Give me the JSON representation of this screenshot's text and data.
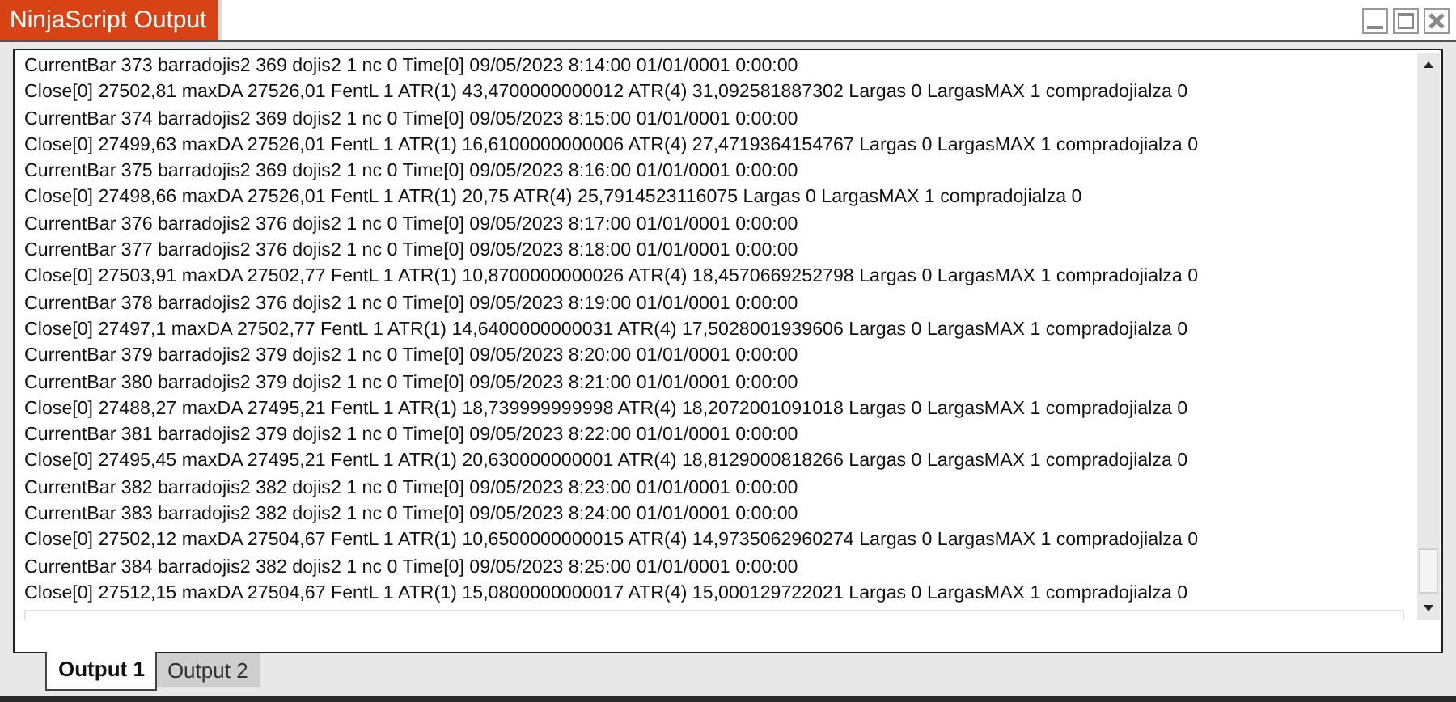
{
  "window": {
    "title": "NinjaScript Output"
  },
  "output_lines": [
    "CurrentBar 373 barradojis2 369 dojis2 1 nc 0 Time[0] 09/05/2023 8:14:00 01/01/0001 0:00:00",
    "Close[0] 27502,81 maxDA 27526,01 FentL 1 ATR(1) 43,4700000000012 ATR(4) 31,092581887302 Largas 0 LargasMAX 1 compradojialza 0",
    "CurrentBar 374 barradojis2 369 dojis2 1 nc 0 Time[0] 09/05/2023 8:15:00 01/01/0001 0:00:00",
    "Close[0] 27499,63 maxDA 27526,01 FentL 1 ATR(1) 16,6100000000006 ATR(4) 27,4719364154767 Largas 0 LargasMAX 1 compradojialza 0",
    "CurrentBar 375 barradojis2 369 dojis2 1 nc 0 Time[0] 09/05/2023 8:16:00 01/01/0001 0:00:00",
    "Close[0] 27498,66 maxDA 27526,01 FentL 1 ATR(1) 20,75 ATR(4) 25,7914523116075 Largas 0 LargasMAX 1 compradojialza 0",
    "CurrentBar 376 barradojis2 376 dojis2 1 nc 0 Time[0] 09/05/2023 8:17:00 01/01/0001 0:00:00",
    "CurrentBar 377 barradojis2 376 dojis2 1 nc 0 Time[0] 09/05/2023 8:18:00 01/01/0001 0:00:00",
    "Close[0] 27503,91 maxDA 27502,77 FentL 1 ATR(1) 10,8700000000026 ATR(4) 18,4570669252798 Largas 0 LargasMAX 1 compradojialza 0",
    "CurrentBar 378 barradojis2 376 dojis2 1 nc 0 Time[0] 09/05/2023 8:19:00 01/01/0001 0:00:00",
    "Close[0] 27497,1 maxDA 27502,77 FentL 1 ATR(1) 14,6400000000031 ATR(4) 17,5028001939606 Largas 0 LargasMAX 1 compradojialza 0",
    "CurrentBar 379 barradojis2 379 dojis2 1 nc 0 Time[0] 09/05/2023 8:20:00 01/01/0001 0:00:00",
    "CurrentBar 380 barradojis2 379 dojis2 1 nc 0 Time[0] 09/05/2023 8:21:00 01/01/0001 0:00:00",
    "Close[0] 27488,27 maxDA 27495,21 FentL 1 ATR(1) 18,739999999998 ATR(4) 18,2072001091018 Largas 0 LargasMAX 1 compradojialza 0",
    "CurrentBar 381 barradojis2 379 dojis2 1 nc 0 Time[0] 09/05/2023 8:22:00 01/01/0001 0:00:00",
    "Close[0] 27495,45 maxDA 27495,21 FentL 1 ATR(1) 20,630000000001 ATR(4) 18,8129000818266 Largas 0 LargasMAX 1 compradojialza 0",
    "CurrentBar 382 barradojis2 382 dojis2 1 nc 0 Time[0] 09/05/2023 8:23:00 01/01/0001 0:00:00",
    "CurrentBar 383 barradojis2 382 dojis2 1 nc 0 Time[0] 09/05/2023 8:24:00 01/01/0001 0:00:00",
    "Close[0] 27502,12 maxDA 27504,67 FentL 1 ATR(1) 10,6500000000015 ATR(4) 14,9735062960274 Largas 0 LargasMAX 1 compradojialza 0",
    "CurrentBar 384 barradojis2 382 dojis2 1 nc 0 Time[0] 09/05/2023 8:25:00 01/01/0001 0:00:00",
    "Close[0] 27512,15 maxDA 27504,67 FentL 1 ATR(1) 15,0800000000017 ATR(4) 15,000129722021 Largas 0 LargasMAX 1 compradojialza 0"
  ],
  "tabs": [
    {
      "label": "Output 1",
      "selected": true
    },
    {
      "label": "Output 2",
      "selected": false
    }
  ]
}
